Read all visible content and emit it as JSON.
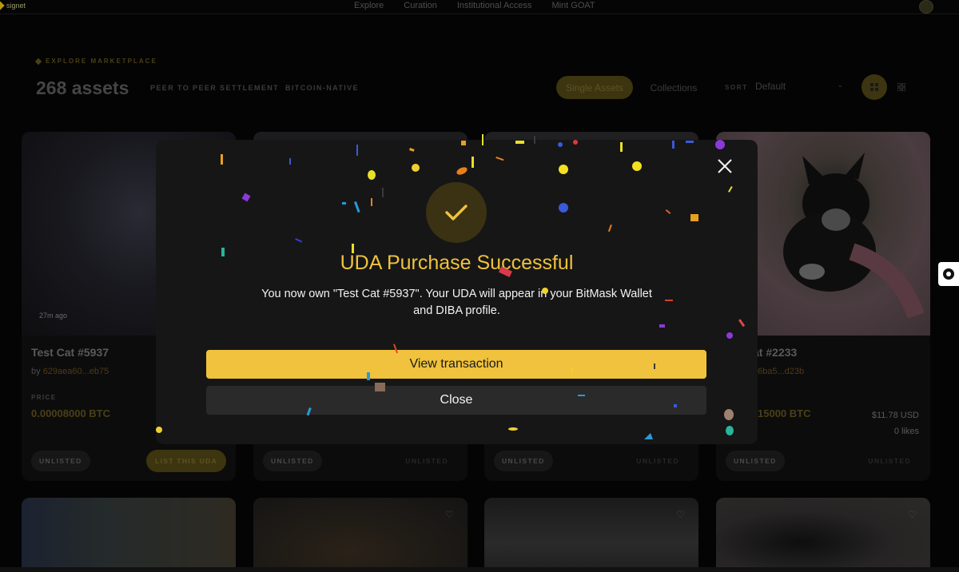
{
  "nav": {
    "brand": "signet",
    "links": [
      "Explore",
      "Curation",
      "Institutional Access",
      "Mint GOAT"
    ]
  },
  "market": {
    "eyebrow": "EXPLORE MARKETPLACE",
    "count": "268 assets",
    "tag1": "PEER TO PEER SETTLEMENT",
    "tag2": "BITCOIN-NATIVE",
    "seg_single": "Single Assets",
    "seg_collections": "Collections",
    "sort_label": "SORT",
    "sort_value": "Default"
  },
  "cards": [
    {
      "time": "27m ago",
      "title": "Test Cat #5937",
      "by": "by",
      "owner": "629aea60...eb75",
      "price_label": "PRICE",
      "price": "0.00008000 BTC",
      "status": "UNLISTED",
      "action": "LIST THIS UDA"
    },
    {
      "status": "UNLISTED",
      "status_right": "UNLISTED"
    },
    {
      "status": "UNLISTED",
      "status_right": "UNLISTED"
    },
    {
      "title": "at #2233",
      "owner": "6ba5...d23b",
      "price": "15000 BTC",
      "usd": "$11.78 USD",
      "likes": "0 likes",
      "status": "UNLISTED",
      "status_right": "UNLISTED"
    }
  ],
  "modal": {
    "title": "UDA Purchase Successful",
    "message": "You now own \"Test Cat #5937\". Your UDA will appear in your BitMask Wallet and DIBA profile.",
    "view_button": "View transaction",
    "close_button": "Close"
  },
  "colors": {
    "accent": "#f0c23d",
    "modal_bg": "#161616",
    "backdrop": "#000000"
  },
  "icons": {
    "close": "close-icon",
    "check": "check-icon",
    "heart": "heart-icon",
    "chevron": "chevron-down-icon"
  }
}
